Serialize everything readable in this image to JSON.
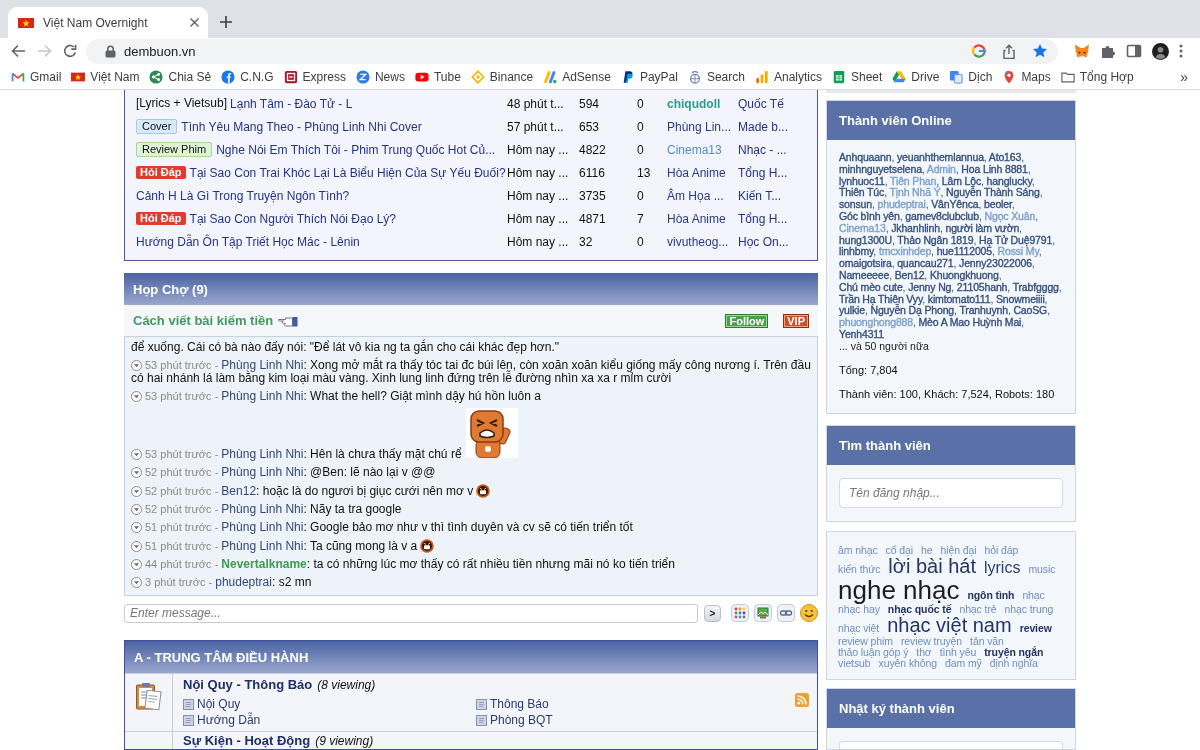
{
  "browser": {
    "tabs": [
      {
        "title": "Việt Nam Overnight",
        "selected": true
      }
    ],
    "nav": {
      "back_disabled": false,
      "forward_disabled": true
    },
    "url": "dembuon.vn",
    "bookmarked": true,
    "bookmarks": [
      {
        "label": "Gmail",
        "kind": "mail"
      },
      {
        "label": "Việt Nam",
        "kind": "flag"
      },
      {
        "label": "Chia Sẻ",
        "kind": "share"
      },
      {
        "label": "C.N.G",
        "kind": "circle"
      },
      {
        "label": "Express",
        "kind": "square"
      },
      {
        "label": "News",
        "kind": "zigzag"
      },
      {
        "label": "Tube",
        "kind": "play"
      },
      {
        "label": "Binance",
        "kind": "diamond"
      },
      {
        "label": "AdSense",
        "kind": "bars"
      },
      {
        "label": "PayPal",
        "kind": "logo"
      },
      {
        "label": "Search",
        "kind": "globe"
      },
      {
        "label": "Analytics",
        "kind": "chart"
      },
      {
        "label": "Sheet",
        "kind": "sheet"
      },
      {
        "label": "Drive",
        "kind": "triangle"
      },
      {
        "label": "Dịch",
        "kind": "translate"
      },
      {
        "label": "Maps",
        "kind": "pin"
      },
      {
        "label": "Tổng Hợp",
        "kind": "folder"
      }
    ],
    "more": "»"
  },
  "threads": {
    "rows": [
      {
        "prefix": {
          "label": "[Lyrics + Vietsub]",
          "kind": "text"
        },
        "title": "Lạnh Tâm - Đào Tử - L",
        "time": "48 phút t...",
        "views": "594",
        "replies": "0",
        "user": {
          "name": "chiqudoll",
          "color": "#2b9c8e",
          "bold": true
        },
        "forum": "Quốc Tế"
      },
      {
        "prefix": {
          "label": "Cover",
          "kind": "info"
        },
        "title": "Tình Yêu Mang Theo - Phùng Linh Nhi Cover",
        "time": "57 phút t...",
        "views": "653",
        "replies": "0",
        "user": {
          "name": "Phùng Lin...",
          "color": "#283a86",
          "bold": false
        },
        "forum": "Made b..."
      },
      {
        "prefix": {
          "label": "Review Phim",
          "kind": "success"
        },
        "title": "Nghe Nói Em Thích Tôi - Phim Trung Quốc Hot Củ...",
        "time": "Hôm nay ...",
        "views": "4822",
        "replies": "0",
        "user": {
          "name": "Cinema13",
          "color": "#4a8fd0",
          "bold": false
        },
        "forum": "Nhạc - ..."
      },
      {
        "prefix": {
          "label": "Hỏi Đáp",
          "kind": "alert"
        },
        "title": "Tại Sao Con Trai Khóc Lại Là Biểu Hiện Của Sự Yếu Đuối?",
        "time": "Hôm nay ...",
        "views": "6116",
        "replies": "13",
        "user": {
          "name": "Hòa Anime",
          "color": "#283a86",
          "bold": false
        },
        "forum": "Tổng H..."
      },
      {
        "title": "Cảnh H Là Gì Trong Truyện Ngôn Tình?",
        "time": "Hôm nay ...",
        "views": "3735",
        "replies": "0",
        "user": {
          "name": "Âm Họa ...",
          "color": "#283a86",
          "bold": false
        },
        "forum": "Kiến T..."
      },
      {
        "prefix": {
          "label": "Hỏi Đáp",
          "kind": "alert"
        },
        "title": "Tại Sao Con Người Thích Nói Đạo Lý?",
        "time": "Hôm nay ...",
        "views": "4871",
        "replies": "7",
        "user": {
          "name": "Hòa Anime",
          "color": "#283a86",
          "bold": false
        },
        "forum": "Tổng H..."
      },
      {
        "title": "Hướng Dẫn Ôn Tập Triết Học Mác - Lênin",
        "time": "Hôm nay ...",
        "views": "32",
        "replies": "0",
        "user": {
          "name": "vivutheog...",
          "color": "#283a86",
          "bold": false
        },
        "forum": "Học On..."
      }
    ]
  },
  "chat": {
    "title": "Họp Chợ (9)",
    "promo": "Cách viết bài kiếm tiền",
    "follow": "Follow",
    "vip": "VIP",
    "separators": {
      "time": "-",
      "user": ":"
    },
    "messages": [
      {
        "kind": "continuation",
        "text": "để xuống. Cái có bà nào đấy nói: \"Để lát vô kia ng ta gắn cho cái khác đẹp hơn.\""
      },
      {
        "kind": "message",
        "time": "53 phút trước",
        "user": {
          "name": "Phùng Linh Nhi",
          "color": "#33477a",
          "bold": false
        },
        "text": "Xong mở mắt ra thấy tóc tai đc búi lên, còn xoăn xoăn kiểu giống mấy công nương í. Trên đầu có hai nhánh lá làm bằng kim loại màu vàng. Xinh lung linh đứng trên lễ đường nhìn xa xa r mỉm cười"
      },
      {
        "kind": "message",
        "time": "53 phút trước",
        "user": {
          "name": "Phùng Linh Nhi",
          "color": "#33477a",
          "bold": false
        },
        "text": "What the hell? Giật mình dậy hú hồn luôn a"
      },
      {
        "kind": "message",
        "time": "53 phút trước",
        "user": {
          "name": "Phùng Linh Nhi",
          "color": "#33477a",
          "bold": false
        },
        "text": "Hên là chưa thấy mặt chú rể",
        "attachment": {
          "kind": "sticker"
        }
      },
      {
        "kind": "message",
        "time": "52 phút trước",
        "user": {
          "name": "Phùng Linh Nhi",
          "color": "#33477a",
          "bold": false
        },
        "text": "@Ben: lẽ nào lại v @@"
      },
      {
        "kind": "message",
        "time": "52 phút trước",
        "user": {
          "name": "Ben12",
          "color": "#33477a",
          "bold": false
        },
        "text": "hoặc là do ngươi bị giục cưới nên mơ v",
        "attachment": {
          "kind": "emoji"
        }
      },
      {
        "kind": "message",
        "time": "52 phút trước",
        "user": {
          "name": "Phùng Linh Nhi",
          "color": "#33477a",
          "bold": false
        },
        "text": "Nãy ta tra google"
      },
      {
        "kind": "message",
        "time": "51 phút trước",
        "user": {
          "name": "Phùng Linh Nhi",
          "color": "#33477a",
          "bold": false
        },
        "text": "Google bảo mơ như v thì tình duyên và cv sẽ có tiến triển tốt"
      },
      {
        "kind": "message",
        "time": "51 phút trước",
        "user": {
          "name": "Phùng Linh Nhi",
          "color": "#33477a",
          "bold": false
        },
        "text": "Ta cũng mong là v a",
        "attachment": {
          "kind": "emoji"
        }
      },
      {
        "kind": "message",
        "time": "44 phút trước",
        "user": {
          "name": "Nevertalkname",
          "color": "#3f9a52",
          "bold": true
        },
        "text": "ta có những lúc mơ thấy có rất nhiều tiền nhưng mãi nó ko tiến triển"
      },
      {
        "kind": "message",
        "time": "3 phút trước",
        "user": {
          "name": "phudeptrai",
          "color": "#33477a",
          "bold": false
        },
        "text": "s2 mn"
      }
    ],
    "input": {
      "placeholder": "Enter message..."
    },
    "send": ">"
  },
  "forum_section": {
    "title": "A - TRUNG TÂM ĐIỀU HÀNH",
    "forums": [
      {
        "title": "Nội Quy - Thông Báo",
        "viewing": "(8 viewing)",
        "subforums": [
          "Nội Quy",
          "Thông Báo",
          "Hướng Dẫn",
          "Phòng BQT"
        ],
        "rss": true
      },
      {
        "title": "Sự Kiện - Hoạt Động",
        "viewing": "(9 viewing)",
        "rss": false
      }
    ]
  },
  "online": {
    "title": "Thành viên Online",
    "separator": ", ",
    "members": [
      {
        "name": "Anhquaann",
        "color": "#35507e"
      },
      {
        "name": "yeuanhthemlannua",
        "color": "#35507e"
      },
      {
        "name": "Ato163",
        "color": "#35507e"
      },
      {
        "name": "minhnguyetselena",
        "color": "#35507e"
      },
      {
        "name": "Admin",
        "color": "#7aa0cc"
      },
      {
        "name": "Hoa Linh 8881",
        "color": "#35507e"
      },
      {
        "name": "lynhuoc11",
        "color": "#35507e"
      },
      {
        "name": "Tiên Phan",
        "color": "#7aa0cc"
      },
      {
        "name": "Lâm Lộc",
        "color": "#35507e"
      },
      {
        "name": "hanglucky",
        "color": "#35507e"
      },
      {
        "name": "Thiên Túc",
        "color": "#35507e"
      },
      {
        "name": "Tịnh Nhã Ý",
        "color": "#7aa0cc"
      },
      {
        "name": "Nguyễn Thành Sáng",
        "color": "#35507e"
      },
      {
        "name": "sonsun",
        "color": "#35507e"
      },
      {
        "name": "phudeptrai",
        "color": "#7aa0cc"
      },
      {
        "name": "VânYênca",
        "color": "#35507e"
      },
      {
        "name": "beoler",
        "color": "#35507e"
      },
      {
        "name": "Góc bình yên",
        "color": "#35507e"
      },
      {
        "name": "gamev8clubclub",
        "color": "#35507e"
      },
      {
        "name": "Ngọc Xuân",
        "color": "#7aa0cc"
      },
      {
        "name": "Cinema13",
        "color": "#7aa0cc"
      },
      {
        "name": "Jkhanhlinh",
        "color": "#35507e"
      },
      {
        "name": "người làm vườn",
        "color": "#35507e"
      },
      {
        "name": "hung1300U",
        "color": "#35507e"
      },
      {
        "name": "Thảo Ngân 1819",
        "color": "#35507e"
      },
      {
        "name": "Hạ Tử Duệ9791",
        "color": "#35507e"
      },
      {
        "name": "linhbmy",
        "color": "#35507e"
      },
      {
        "name": "tmcxinhdep",
        "color": "#7aa0cc"
      },
      {
        "name": "hue1112005",
        "color": "#35507e"
      },
      {
        "name": "Rossi My",
        "color": "#7aa0cc"
      },
      {
        "name": "omaigotsira",
        "color": "#35507e"
      },
      {
        "name": "quancau271",
        "color": "#35507e"
      },
      {
        "name": "Jenny23022006",
        "color": "#35507e"
      },
      {
        "name": "Nameeeee",
        "color": "#35507e"
      },
      {
        "name": "Ben12",
        "color": "#35507e"
      },
      {
        "name": "Khuongkhuong",
        "color": "#35507e"
      },
      {
        "name": "Chú mèo cute",
        "color": "#35507e"
      },
      {
        "name": "Jenny Ng",
        "color": "#35507e"
      },
      {
        "name": "21105hanh",
        "color": "#35507e"
      },
      {
        "name": "Trabfgggg",
        "color": "#35507e"
      },
      {
        "name": "Trần Hạ Thiên Vyy",
        "color": "#35507e"
      },
      {
        "name": "kimtomato111",
        "color": "#35507e"
      },
      {
        "name": "Snowmeiiii",
        "color": "#35507e"
      },
      {
        "name": "yulkie",
        "color": "#35507e"
      },
      {
        "name": "Nguyễn Dạ Phong",
        "color": "#35507e"
      },
      {
        "name": "Tranhuynh",
        "color": "#35507e"
      },
      {
        "name": "CaoSG",
        "color": "#35507e"
      },
      {
        "name": "phuonghong888",
        "color": "#7aa0cc"
      },
      {
        "name": "Mèo A Mao Huỳnh Mai",
        "color": "#35507e"
      },
      {
        "name": "Yenh4311",
        "color": "#35507e"
      }
    ],
    "more": "... và 50 người nữa",
    "total": "Tổng: 7,804",
    "breakdown": "Thành viên: 100, Khách: 7,524, Robots: 180"
  },
  "member_search": {
    "title": "Tìm thành viên",
    "placeholder": "Tên đăng nhập..."
  },
  "tags": [
    {
      "label": "âm nhạc",
      "kind": "tiny"
    },
    {
      "label": "cổ đại",
      "kind": "tiny"
    },
    {
      "label": "he",
      "kind": "tiny"
    },
    {
      "label": "hiện đại",
      "kind": "tiny"
    },
    {
      "label": "hỏi đáp",
      "kind": "tiny"
    },
    {
      "label": "kiến thức",
      "kind": "tiny"
    },
    {
      "label": "lời bài hát",
      "kind": "large"
    },
    {
      "label": "lyrics",
      "kind": "medium"
    },
    {
      "label": "music",
      "kind": "tiny"
    },
    {
      "label": "nghe nhạc",
      "kind": "huge"
    },
    {
      "label": "ngôn tình",
      "kind": "small"
    },
    {
      "label": "nhạc",
      "kind": "tiny"
    },
    {
      "label": "nhạc hay",
      "kind": "tiny"
    },
    {
      "label": "nhạc quốc tế",
      "kind": "small"
    },
    {
      "label": "nhạc trẻ",
      "kind": "tiny"
    },
    {
      "label": "nhạc trung",
      "kind": "tiny"
    },
    {
      "label": "nhạc việt",
      "kind": "tiny"
    },
    {
      "label": "nhạc việt nam",
      "kind": "large"
    },
    {
      "label": "review",
      "kind": "small"
    },
    {
      "label": "review phim",
      "kind": "tiny"
    },
    {
      "label": "review truyện",
      "kind": "tiny"
    },
    {
      "label": "tản văn",
      "kind": "tiny"
    },
    {
      "label": "thảo luận góp ý",
      "kind": "tiny"
    },
    {
      "label": "thơ",
      "kind": "tiny"
    },
    {
      "label": "tình yêu",
      "kind": "tiny"
    },
    {
      "label": "truyện ngắn",
      "kind": "small"
    },
    {
      "label": "vietsub",
      "kind": "tiny"
    },
    {
      "label": "xuyên không",
      "kind": "tiny"
    },
    {
      "label": "đam mỹ",
      "kind": "tiny"
    },
    {
      "label": "định nghĩa",
      "kind": "tiny"
    }
  ],
  "member_journal": {
    "title": "Nhật ký thành viên"
  }
}
